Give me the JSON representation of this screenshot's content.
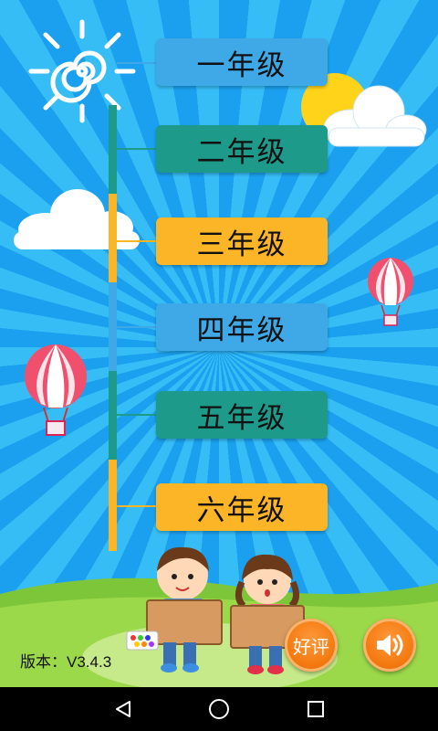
{
  "grades": [
    {
      "label": "一年级",
      "color": "#3fa8e6"
    },
    {
      "label": "二年级",
      "color": "#1e9a8a"
    },
    {
      "label": "三年级",
      "color": "#fbb527"
    },
    {
      "label": "四年级",
      "color": "#3fa8e6"
    },
    {
      "label": "五年级",
      "color": "#1e9a8a"
    },
    {
      "label": "六年级",
      "color": "#fbb527"
    }
  ],
  "footer": {
    "version_text": "版本：V3.4.3",
    "rate_label": "好评",
    "sound_icon": "speaker-icon"
  },
  "navbar": {
    "back_icon": "back-triangle-icon",
    "home_icon": "home-circle-icon",
    "recents_icon": "recents-square-icon"
  },
  "colors": {
    "background": "#1aa0ee",
    "accent_orange": "#f47a10",
    "grass": "#8fd140"
  }
}
